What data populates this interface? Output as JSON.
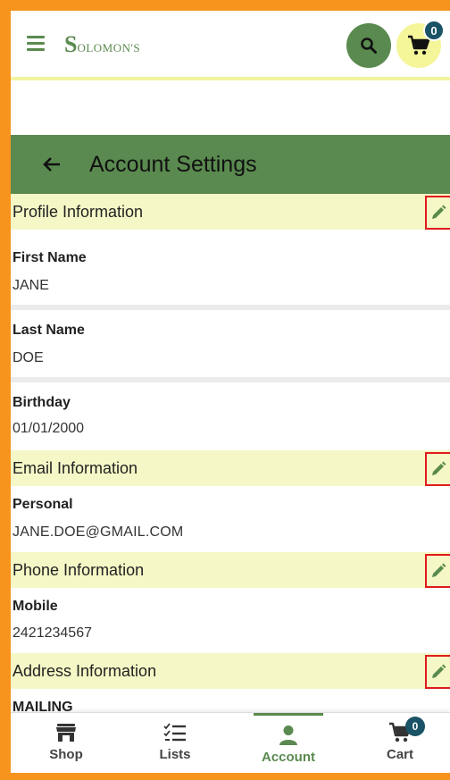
{
  "header": {
    "logo_big": "S",
    "logo_small": "OLOMON'S",
    "cart_count": "0"
  },
  "page": {
    "title": "Account Settings"
  },
  "sections": {
    "profile": {
      "heading": "Profile Information",
      "first_name_label": "First Name",
      "first_name_value": "JANE",
      "last_name_label": "Last Name",
      "last_name_value": "DOE",
      "birthday_label": "Birthday",
      "birthday_value": "01/01/2000"
    },
    "email": {
      "heading": "Email Information",
      "personal_label": "Personal",
      "personal_value": "JANE.DOE@GMAIL.COM"
    },
    "phone": {
      "heading": "Phone Information",
      "mobile_label": "Mobile",
      "mobile_value": "2421234567"
    },
    "address": {
      "heading": "Address Information",
      "mailing_label": "MAILING"
    }
  },
  "bottom_nav": {
    "shop": "Shop",
    "lists": "Lists",
    "account": "Account",
    "cart": "Cart",
    "cart_count": "0"
  },
  "colors": {
    "brand_green": "#5a8a4f",
    "highlight_yellow": "#f5f8c6",
    "badge_blue": "#1a5266",
    "frame_orange": "#f7941d",
    "edit_outline_red": "#e01b1b"
  },
  "icons": [
    "hamburger-icon",
    "search-icon",
    "cart-icon",
    "back-arrow-icon",
    "pencil-icon",
    "shop-icon",
    "lists-icon",
    "account-icon"
  ]
}
